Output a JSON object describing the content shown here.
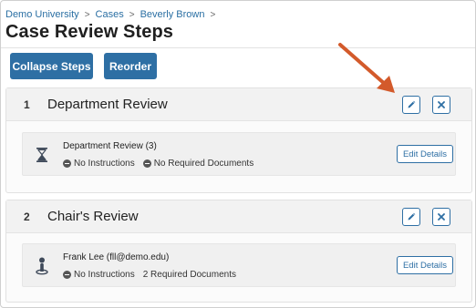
{
  "breadcrumb": {
    "items": [
      "Demo University",
      "Cases",
      "Beverly Brown"
    ],
    "separator": ">"
  },
  "page": {
    "title": "Case Review Steps"
  },
  "toolbar": {
    "collapse_label": "Collapse Steps",
    "reorder_label": "Reorder"
  },
  "steps": [
    {
      "number": "1",
      "title": "Department Review",
      "card": {
        "icon": "hourglass-icon",
        "title": "Department Review (3)",
        "instructions": "No Instructions",
        "documents": "No Required Documents",
        "edit_label": "Edit Details"
      }
    },
    {
      "number": "2",
      "title": "Chair's Review",
      "card": {
        "icon": "person-pin-icon",
        "title": "Frank Lee (fll@demo.edu)",
        "instructions": "No Instructions",
        "documents": "2 Required Documents",
        "edit_label": "Edit Details"
      }
    }
  ],
  "colors": {
    "primary": "#2e6fa4",
    "link": "#2a6fa3",
    "annotation_arrow": "#d35a2b"
  }
}
